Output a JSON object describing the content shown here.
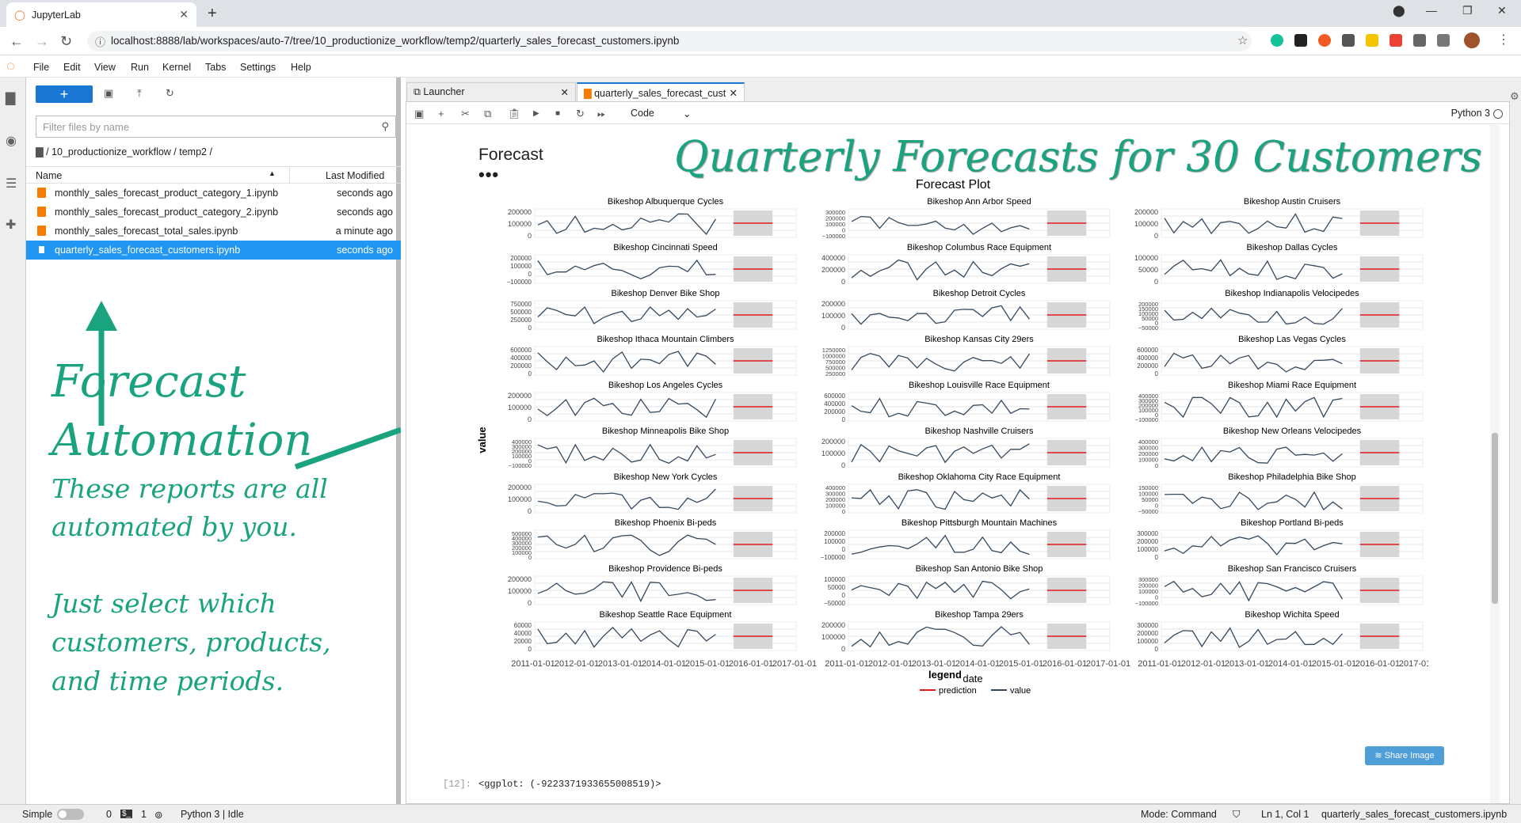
{
  "browser": {
    "tab_title": "JupyterLab",
    "url": "localhost:8888/lab/workspaces/auto-7/tree/10_productionize_workflow/temp2/quarterly_sales_forecast_customers.ipynb"
  },
  "menu": [
    "File",
    "Edit",
    "View",
    "Run",
    "Kernel",
    "Tabs",
    "Settings",
    "Help"
  ],
  "filebrowser": {
    "filter_placeholder": "Filter files by name",
    "breadcrumb": "/ 10_productionize_workflow / temp2 /",
    "col_name": "Name",
    "col_modified": "Last Modified",
    "files": [
      {
        "name": "monthly_sales_forecast_product_category_1.ipynb",
        "modified": "seconds ago"
      },
      {
        "name": "monthly_sales_forecast_product_category_2.ipynb",
        "modified": "seconds ago"
      },
      {
        "name": "monthly_sales_forecast_total_sales.ipynb",
        "modified": "a minute ago"
      },
      {
        "name": "quarterly_sales_forecast_customers.ipynb",
        "modified": "seconds ago"
      }
    ]
  },
  "tabs": [
    {
      "label": "Launcher"
    },
    {
      "label": "quarterly_sales_forecast_cust"
    }
  ],
  "toolbar": {
    "cell_type": "Code",
    "kernel": "Python 3"
  },
  "notebook": {
    "heading": "Forecast",
    "overlay_title": "Quarterly Forecasts for 30 Customers",
    "output_prompt": "[12]:",
    "output_text": "<ggplot: (-9223371933655008519)>",
    "share_label": "Share Image"
  },
  "annotation": {
    "line1": "Forecast",
    "line2": "Automation",
    "line3": "These reports are all",
    "line4": "automated by you.",
    "line5": "Just select which",
    "line6": "customers, products,",
    "line7": "and time periods."
  },
  "status": {
    "mode_label": "Simple",
    "terminals": "0",
    "kernels": "1",
    "kernel_status": "Python 3 | Idle",
    "mode": "Mode: Command",
    "cursor": "Ln 1, Col 1",
    "file": "quarterly_sales_forecast_customers.ipynb"
  },
  "colors": {
    "accent": "#1976d2",
    "annotation": "#1aa37f",
    "prediction": "#e41a1c",
    "value": "#34495e"
  },
  "chart_data": {
    "type": "line",
    "title": "Forecast Plot",
    "xlabel": "date",
    "ylabel": "value",
    "x_ticks": [
      "2011-01-01",
      "2012-01-01",
      "2013-01-01",
      "2014-01-01",
      "2015-01-01",
      "2016-01-01",
      "2017-01-01"
    ],
    "legend": {
      "title": "legend",
      "entries": [
        "prediction",
        "value"
      ],
      "placement": "bottom"
    },
    "panels": [
      {
        "title": "Bikeshop Albuquerque Cycles",
        "yticks": [
          "200000",
          "100000",
          "0"
        ]
      },
      {
        "title": "Bikeshop Ann Arbor Speed",
        "yticks": [
          "300000",
          "200000",
          "100000",
          "0",
          "−100000"
        ]
      },
      {
        "title": "Bikeshop Austin Cruisers",
        "yticks": [
          "200000",
          "100000",
          "0"
        ]
      },
      {
        "title": "Bikeshop Cincinnati Speed",
        "yticks": [
          "200000",
          "100000",
          "0",
          "−100000"
        ]
      },
      {
        "title": "Bikeshop Columbus Race Equipment",
        "yticks": [
          "400000",
          "200000",
          "0"
        ]
      },
      {
        "title": "Bikeshop Dallas Cycles",
        "yticks": [
          "100000",
          "50000",
          "0"
        ]
      },
      {
        "title": "Bikeshop Denver Bike Shop",
        "yticks": [
          "750000",
          "500000",
          "250000",
          "0"
        ]
      },
      {
        "title": "Bikeshop Detroit Cycles",
        "yticks": [
          "200000",
          "100000",
          "0"
        ]
      },
      {
        "title": "Bikeshop Indianapolis Velocipedes",
        "yticks": [
          "200000",
          "150000",
          "100000",
          "50000",
          "0",
          "−50000"
        ]
      },
      {
        "title": "Bikeshop Ithaca Mountain Climbers",
        "yticks": [
          "600000",
          "400000",
          "200000",
          "0"
        ]
      },
      {
        "title": "Bikeshop Kansas City 29ers",
        "yticks": [
          "1250000",
          "1000000",
          "750000",
          "500000",
          "250000"
        ]
      },
      {
        "title": "Bikeshop Las Vegas Cycles",
        "yticks": [
          "600000",
          "400000",
          "200000",
          "0"
        ]
      },
      {
        "title": "Bikeshop Los Angeles Cycles",
        "yticks": [
          "200000",
          "100000",
          "0"
        ]
      },
      {
        "title": "Bikeshop Louisville Race Equipment",
        "yticks": [
          "600000",
          "400000",
          "200000",
          "0"
        ]
      },
      {
        "title": "Bikeshop Miami Race Equipment",
        "yticks": [
          "400000",
          "300000",
          "200000",
          "100000",
          "0",
          "−100000"
        ]
      },
      {
        "title": "Bikeshop Minneapolis Bike Shop",
        "yticks": [
          "400000",
          "300000",
          "200000",
          "100000",
          "0",
          "−100000"
        ]
      },
      {
        "title": "Bikeshop Nashville Cruisers",
        "yticks": [
          "200000",
          "100000",
          "0"
        ]
      },
      {
        "title": "Bikeshop New Orleans Velocipedes",
        "yticks": [
          "400000",
          "300000",
          "200000",
          "100000",
          "0"
        ]
      },
      {
        "title": "Bikeshop New York Cycles",
        "yticks": [
          "200000",
          "100000",
          "0"
        ]
      },
      {
        "title": "Bikeshop Oklahoma City Race Equipment",
        "yticks": [
          "400000",
          "300000",
          "200000",
          "100000",
          "0"
        ]
      },
      {
        "title": "Bikeshop Philadelphia Bike Shop",
        "yticks": [
          "150000",
          "100000",
          "50000",
          "0",
          "−50000"
        ]
      },
      {
        "title": "Bikeshop Phoenix Bi-peds",
        "yticks": [
          "500000",
          "400000",
          "300000",
          "200000",
          "100000",
          "0"
        ]
      },
      {
        "title": "Bikeshop Pittsburgh Mountain Machines",
        "yticks": [
          "200000",
          "100000",
          "0",
          "−100000"
        ]
      },
      {
        "title": "Bikeshop Portland Bi-peds",
        "yticks": [
          "300000",
          "200000",
          "100000",
          "0"
        ]
      },
      {
        "title": "Bikeshop Providence Bi-peds",
        "yticks": [
          "200000",
          "100000",
          "0"
        ]
      },
      {
        "title": "Bikeshop San Antonio Bike Shop",
        "yticks": [
          "100000",
          "50000",
          "0",
          "−50000"
        ]
      },
      {
        "title": "Bikeshop San Francisco Cruisers",
        "yticks": [
          "300000",
          "200000",
          "100000",
          "0",
          "−100000"
        ]
      },
      {
        "title": "Bikeshop Seattle Race Equipment",
        "yticks": [
          "60000",
          "40000",
          "20000",
          "0"
        ]
      },
      {
        "title": "Bikeshop Tampa 29ers",
        "yticks": [
          "200000",
          "100000",
          "0"
        ]
      },
      {
        "title": "Bikeshop Wichita Speed",
        "yticks": [
          "300000",
          "200000",
          "100000",
          "0"
        ]
      }
    ]
  }
}
